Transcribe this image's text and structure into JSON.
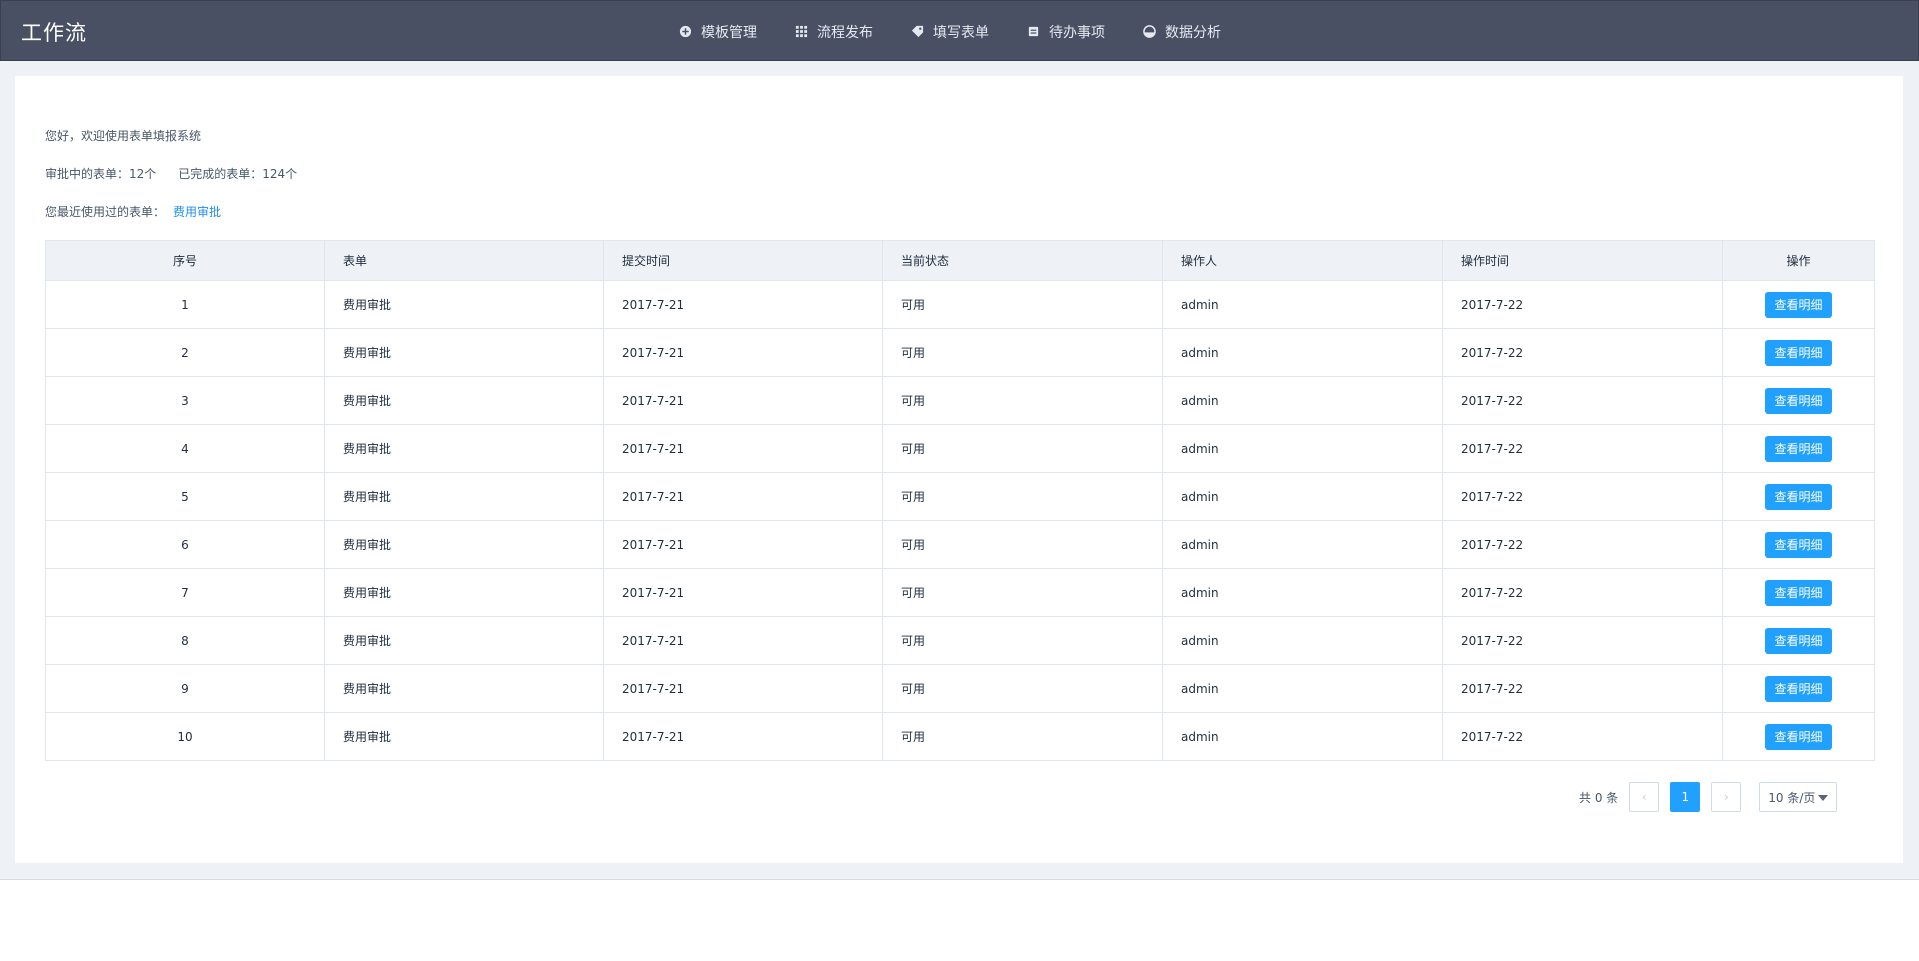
{
  "header": {
    "brand": "工作流",
    "nav": [
      {
        "label": "模板管理",
        "icon": "plus-circle-icon"
      },
      {
        "label": "流程发布",
        "icon": "grid-icon"
      },
      {
        "label": "填写表单",
        "icon": "tag-icon"
      },
      {
        "label": "待办事项",
        "icon": "document-icon"
      },
      {
        "label": "数据分析",
        "icon": "chart-pie-icon"
      }
    ]
  },
  "summary": {
    "greeting": "您好，欢迎使用表单填报系统",
    "in_review": "审批中的表单：12个",
    "completed": "已完成的表单：124个",
    "recent_label": "您最近使用过的表单：",
    "recent_link": "费用审批"
  },
  "table": {
    "columns": [
      "序号",
      "表单",
      "提交时间",
      "当前状态",
      "操作人",
      "操作时间",
      "操作"
    ],
    "rows": [
      [
        "1",
        "费用审批",
        "2017-7-21",
        "可用",
        "admin",
        "2017-7-22",
        "查看明细"
      ],
      [
        "2",
        "费用审批",
        "2017-7-21",
        "可用",
        "admin",
        "2017-7-22",
        "查看明细"
      ],
      [
        "3",
        "费用审批",
        "2017-7-21",
        "可用",
        "admin",
        "2017-7-22",
        "查看明细"
      ],
      [
        "4",
        "费用审批",
        "2017-7-21",
        "可用",
        "admin",
        "2017-7-22",
        "查看明细"
      ],
      [
        "5",
        "费用审批",
        "2017-7-21",
        "可用",
        "admin",
        "2017-7-22",
        "查看明细"
      ],
      [
        "6",
        "费用审批",
        "2017-7-21",
        "可用",
        "admin",
        "2017-7-22",
        "查看明细"
      ],
      [
        "7",
        "费用审批",
        "2017-7-21",
        "可用",
        "admin",
        "2017-7-22",
        "查看明细"
      ],
      [
        "8",
        "费用审批",
        "2017-7-21",
        "可用",
        "admin",
        "2017-7-22",
        "查看明细"
      ],
      [
        "9",
        "费用审批",
        "2017-7-21",
        "可用",
        "admin",
        "2017-7-22",
        "查看明细"
      ],
      [
        "10",
        "费用审批",
        "2017-7-21",
        "可用",
        "admin",
        "2017-7-22",
        "查看明细"
      ]
    ]
  },
  "pagination": {
    "total": "共 0 条",
    "current_page": "1",
    "page_size": "10 条/页"
  },
  "colors": {
    "header_bg": "#4a5064",
    "accent": "#20a0ff"
  }
}
